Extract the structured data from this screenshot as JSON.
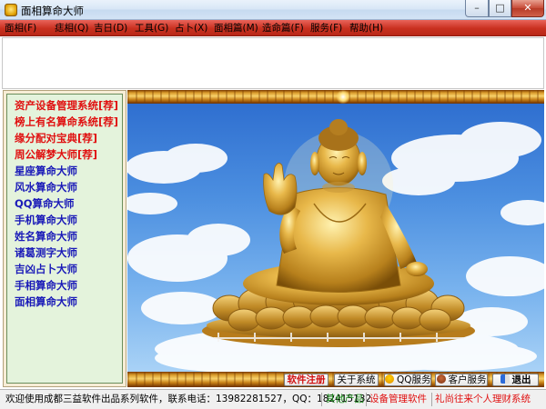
{
  "window": {
    "title": "面相算命大师",
    "controls": {
      "minimize": "–",
      "maximize": "□",
      "close": "✕"
    }
  },
  "menu": {
    "items": [
      {
        "label": "面相(F)"
      },
      {
        "label": "痣相(Q)"
      },
      {
        "label": "吉日(D)"
      },
      {
        "label": "工具(G)"
      },
      {
        "label": "占卜(X)"
      },
      {
        "label": "面相篇(M)"
      },
      {
        "label": "造命篇(F)"
      },
      {
        "label": "服务(F)"
      },
      {
        "label": "帮助(H)"
      }
    ]
  },
  "sidebar": {
    "items": [
      {
        "label": "资产设备管理系统[荐]",
        "color": "#e01010"
      },
      {
        "label": "榜上有名算命系统[荐]",
        "color": "#e01010"
      },
      {
        "label": "缘分配对宝典[荐]",
        "color": "#e01010"
      },
      {
        "label": "周公解梦大师[荐]",
        "color": "#e01010"
      },
      {
        "label": "星座算命大师",
        "color": "#1a1ab8"
      },
      {
        "label": "风水算命大师",
        "color": "#1a1ab8"
      },
      {
        "label": "QQ算命大师",
        "color": "#1a1ab8"
      },
      {
        "label": "手机算命大师",
        "color": "#1a1ab8"
      },
      {
        "label": "姓名算命大师",
        "color": "#1a1ab8"
      },
      {
        "label": "诸葛测字大师",
        "color": "#1a1ab8"
      },
      {
        "label": "吉凶占卜大师",
        "color": "#1a1ab8"
      },
      {
        "label": "手相算命大师",
        "color": "#1a1ab8"
      },
      {
        "label": "面相算命大师",
        "color": "#1a1ab8"
      }
    ]
  },
  "actions": {
    "register": "软件注册",
    "about": "关于系统",
    "qq_service": "QQ服务",
    "customer_service": "客户服务",
    "exit": "退出"
  },
  "statusbar": {
    "welcome": "欢迎使用成都三益软件出品系列软件，联系电话：13982281527，QQ：182415132",
    "other_products": "其他产品",
    "product_1": "设备管理软件",
    "product_2": "礼尚往来个人理财系统"
  },
  "colors": {
    "menubar": "#c9301f",
    "sidebar_bg": "#e4f3dc",
    "highlight_red": "#e01010",
    "link_blue": "#1a1ab8",
    "status_green": "#1a8a1a"
  }
}
